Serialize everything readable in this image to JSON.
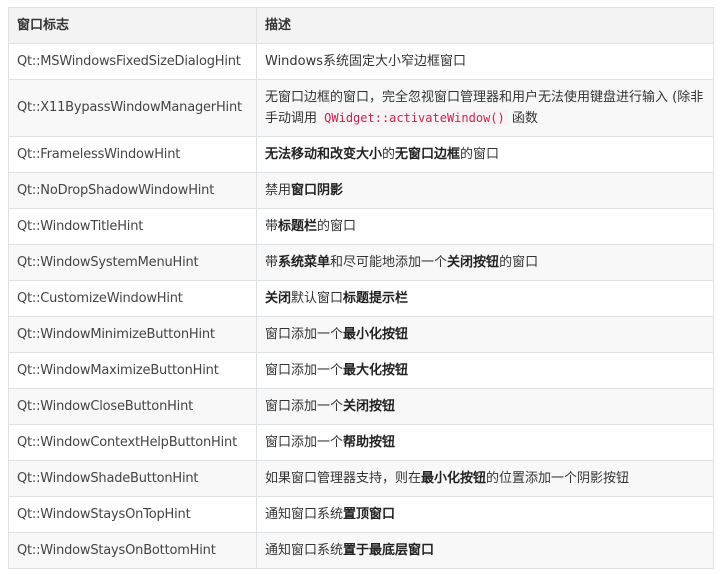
{
  "table": {
    "header": {
      "col1": "窗口标志",
      "col2": "描述"
    },
    "rows": [
      {
        "flag": "Qt::MSWindowsFixedSizeDialogHint",
        "desc": [
          {
            "t": "Windows系统固定大小窄边框窗口"
          }
        ]
      },
      {
        "flag": "Qt::X11BypassWindowManagerHint",
        "desc": [
          {
            "t": "无窗口边框的窗口，完全忽视窗口管理器和用户无法使用键盘进行输入 (除非手动调用 "
          },
          {
            "t": "QWidget::activateWindow()",
            "code": true
          },
          {
            "t": " 函数"
          }
        ]
      },
      {
        "flag": "Qt::FramelessWindowHint",
        "desc": [
          {
            "t": "无法移动和改变大小",
            "b": true
          },
          {
            "t": "的"
          },
          {
            "t": "无窗口边框",
            "b": true
          },
          {
            "t": "的窗口"
          }
        ]
      },
      {
        "flag": "Qt::NoDropShadowWindowHint",
        "desc": [
          {
            "t": "禁用"
          },
          {
            "t": "窗口阴影",
            "b": true
          }
        ]
      },
      {
        "flag": "Qt::WindowTitleHint",
        "desc": [
          {
            "t": "带"
          },
          {
            "t": "标题栏",
            "b": true
          },
          {
            "t": "的窗口"
          }
        ]
      },
      {
        "flag": "Qt::WindowSystemMenuHint",
        "desc": [
          {
            "t": "带"
          },
          {
            "t": "系统菜单",
            "b": true
          },
          {
            "t": "和尽可能地添加一个"
          },
          {
            "t": "关闭按钮",
            "b": true
          },
          {
            "t": "的窗口"
          }
        ]
      },
      {
        "flag": "Qt::CustomizeWindowHint",
        "desc": [
          {
            "t": "关闭",
            "b": true
          },
          {
            "t": "默认窗口"
          },
          {
            "t": "标题提示栏",
            "b": true
          }
        ]
      },
      {
        "flag": "Qt::WindowMinimizeButtonHint",
        "desc": [
          {
            "t": "窗口添加一个"
          },
          {
            "t": "最小化按钮",
            "b": true
          }
        ]
      },
      {
        "flag": "Qt::WindowMaximizeButtonHint",
        "desc": [
          {
            "t": "窗口添加一个"
          },
          {
            "t": "最大化按钮",
            "b": true
          }
        ]
      },
      {
        "flag": "Qt::WindowCloseButtonHint",
        "desc": [
          {
            "t": "窗口添加一个"
          },
          {
            "t": "关闭按钮",
            "b": true
          }
        ]
      },
      {
        "flag": "Qt::WindowContextHelpButtonHint",
        "desc": [
          {
            "t": "窗口添加一个"
          },
          {
            "t": "帮助按钮",
            "b": true
          }
        ]
      },
      {
        "flag": "Qt::WindowShadeButtonHint",
        "desc": [
          {
            "t": "如果窗口管理器支持，则在"
          },
          {
            "t": "最小化按钮",
            "b": true
          },
          {
            "t": "的位置添加一个阴影按钮"
          }
        ]
      },
      {
        "flag": "Qt::WindowStaysOnTopHint",
        "desc": [
          {
            "t": "通知窗口系统"
          },
          {
            "t": "置顶窗口",
            "b": true
          }
        ]
      },
      {
        "flag": "Qt::WindowStaysOnBottomHint",
        "desc": [
          {
            "t": "通知窗口系统"
          },
          {
            "t": "置于最底层窗口",
            "b": true
          }
        ]
      }
    ]
  }
}
